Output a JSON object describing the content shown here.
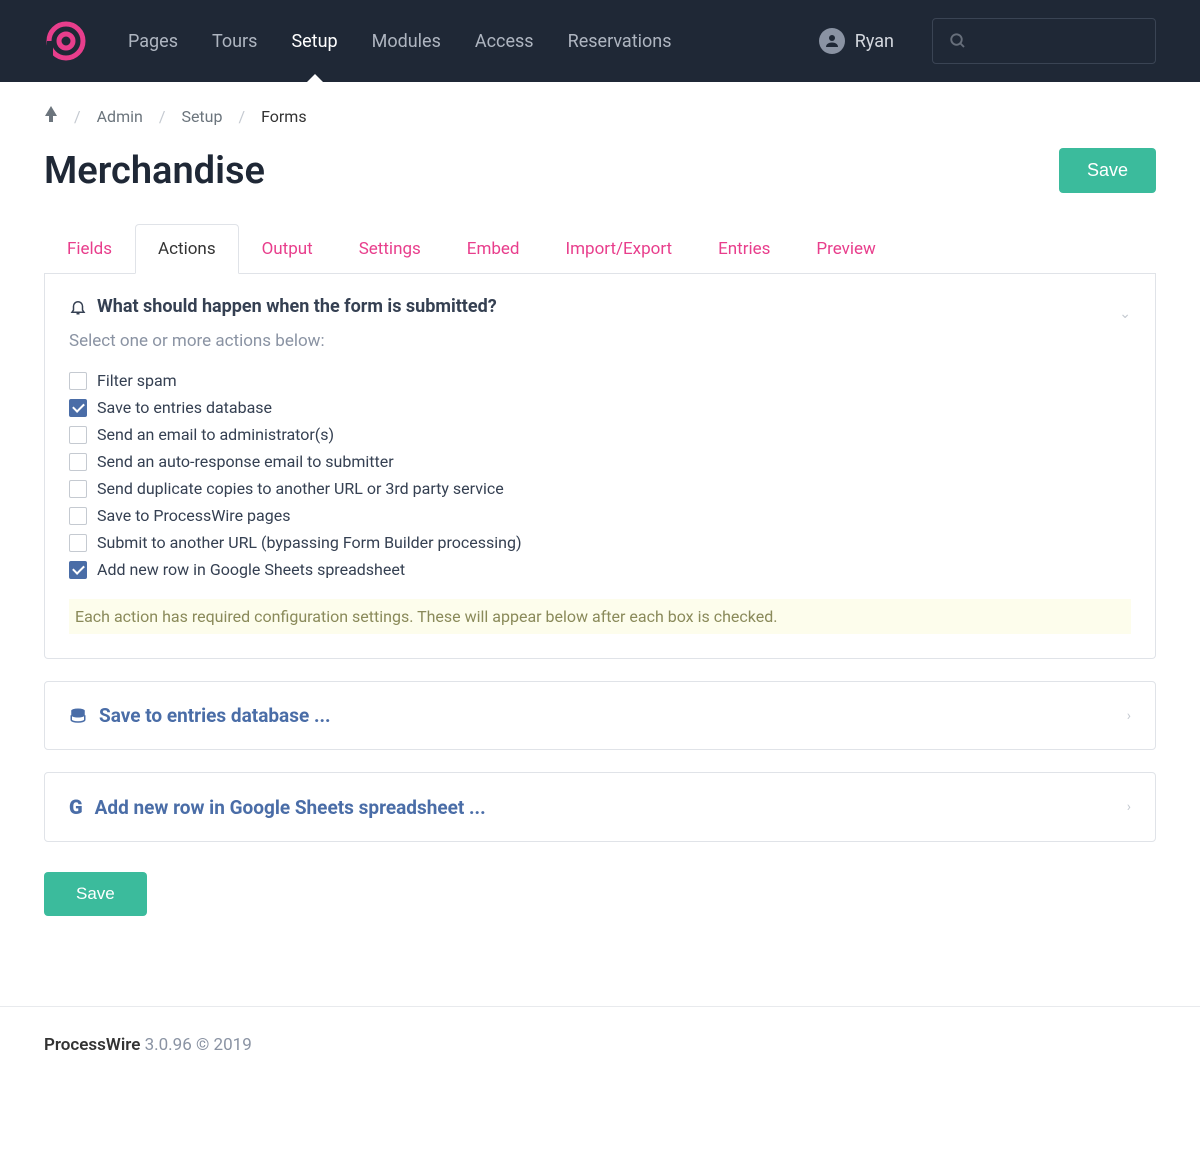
{
  "nav": {
    "items": [
      {
        "label": "Pages",
        "active": false
      },
      {
        "label": "Tours",
        "active": false
      },
      {
        "label": "Setup",
        "active": true
      },
      {
        "label": "Modules",
        "active": false
      },
      {
        "label": "Access",
        "active": false
      },
      {
        "label": "Reservations",
        "active": false
      }
    ]
  },
  "user": {
    "name": "Ryan"
  },
  "breadcrumb": {
    "items": [
      {
        "label": "Admin"
      },
      {
        "label": "Setup"
      },
      {
        "label": "Forms",
        "current": true
      }
    ]
  },
  "page": {
    "title": "Merchandise",
    "save_label": "Save"
  },
  "tabs": [
    {
      "label": "Fields"
    },
    {
      "label": "Actions",
      "active": true
    },
    {
      "label": "Output"
    },
    {
      "label": "Settings"
    },
    {
      "label": "Embed"
    },
    {
      "label": "Import/Export"
    },
    {
      "label": "Entries"
    },
    {
      "label": "Preview"
    }
  ],
  "panel": {
    "title": "What should happen when the form is submitted?",
    "desc": "Select one or more actions below:",
    "options": [
      {
        "label": "Filter spam",
        "checked": false
      },
      {
        "label": "Save to entries database",
        "checked": true
      },
      {
        "label": "Send an email to administrator(s)",
        "checked": false
      },
      {
        "label": "Send an auto-response email to submitter",
        "checked": false
      },
      {
        "label": "Send duplicate copies to another URL or 3rd party service",
        "checked": false
      },
      {
        "label": "Save to ProcessWire pages",
        "checked": false
      },
      {
        "label": "Submit to another URL (bypassing Form Builder processing)",
        "checked": false
      },
      {
        "label": "Add new row in Google Sheets spreadsheet",
        "checked": true
      }
    ],
    "note": "Each action has required configuration settings. These will appear below after each box is checked."
  },
  "collapse1": {
    "title": "Save to entries database ..."
  },
  "collapse2": {
    "title": "Add new row in Google Sheets spreadsheet ..."
  },
  "bottom_save": "Save",
  "footer": {
    "brand": "ProcessWire",
    "version": "3.0.96 © 2019"
  }
}
